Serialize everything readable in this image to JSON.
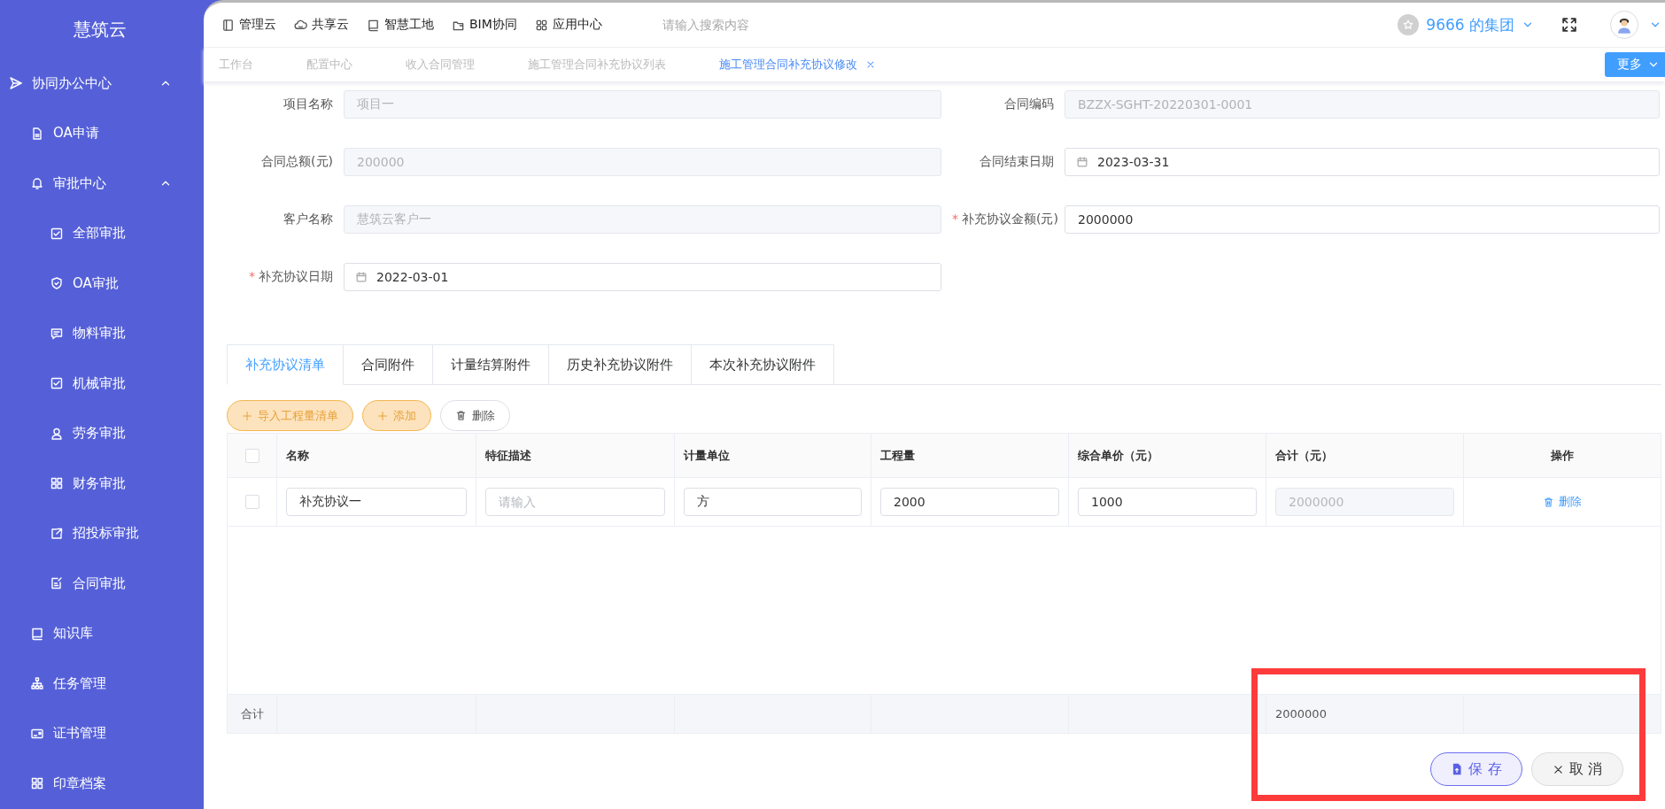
{
  "sidebar": {
    "logo": "慧筑云",
    "items": [
      {
        "label": "协同办公中心",
        "expanded": true,
        "children": [
          {
            "label": "OA申请"
          },
          {
            "label": "审批中心",
            "expanded": true,
            "children": [
              {
                "label": "全部审批"
              },
              {
                "label": "OA审批"
              },
              {
                "label": "物料审批"
              },
              {
                "label": "机械审批"
              },
              {
                "label": "劳务审批"
              },
              {
                "label": "财务审批"
              },
              {
                "label": "招投标审批"
              },
              {
                "label": "合同审批"
              }
            ]
          },
          {
            "label": "知识库"
          },
          {
            "label": "任务管理"
          },
          {
            "label": "证书管理"
          },
          {
            "label": "印章档案"
          }
        ]
      }
    ]
  },
  "top_nav": {
    "items": [
      {
        "label": "管理云"
      },
      {
        "label": "共享云"
      },
      {
        "label": "智慧工地"
      },
      {
        "label": "BIM协同"
      },
      {
        "label": "应用中心"
      }
    ],
    "search": {
      "placeholder": "请输入搜索内容"
    },
    "organization": "9666 的集团"
  },
  "page_tabs": {
    "items": [
      {
        "label": "工作台",
        "selected": false
      },
      {
        "label": "配置中心",
        "selected": false
      },
      {
        "label": "收入合同管理",
        "selected": false
      },
      {
        "label": "施工管理合同补充协议列表",
        "selected": false
      },
      {
        "label": "施工管理合同补充协议修改",
        "selected": true,
        "closable": true
      }
    ],
    "more": "更多"
  },
  "form": {
    "fields": [
      {
        "label": "项目名称",
        "value": "项目一",
        "kind": "text",
        "disabled": true
      },
      {
        "label": "合同编码",
        "value": "BZZX-SGHT-20220301-0001",
        "kind": "text",
        "disabled": true
      },
      {
        "label": "合同总额(元)",
        "value": "200000",
        "kind": "text",
        "disabled": true
      },
      {
        "label": "合同结束日期",
        "value": "2023-03-31",
        "kind": "date",
        "disabled": false
      },
      {
        "label": "客户名称",
        "value": "慧筑云客户一",
        "kind": "text",
        "disabled": true
      },
      {
        "label": "补充协议金额(元)",
        "value": "2000000",
        "kind": "text",
        "disabled": false,
        "required_mark": "*"
      },
      {
        "label": "补充协议日期",
        "value": "2022-03-01",
        "kind": "date",
        "disabled": false,
        "required_mark": "*"
      }
    ]
  },
  "detail_tabs": [
    {
      "label": "补充协议清单",
      "selected": true
    },
    {
      "label": "合同附件",
      "selected": false
    },
    {
      "label": "计量结算附件",
      "selected": false
    },
    {
      "label": "历史补充协议附件",
      "selected": false
    },
    {
      "label": "本次补充协议附件",
      "selected": false
    }
  ],
  "toolbar": [
    {
      "label": "导入工程量清单",
      "kind": "warning"
    },
    {
      "label": "添加",
      "kind": "warning"
    },
    {
      "label": "删除",
      "kind": "default"
    }
  ],
  "table": {
    "select_all": {
      "checked": false
    },
    "columns": [
      "名称",
      "特征描述",
      "计量单位",
      "工程量",
      "综合单价（元）",
      "合计（元）",
      "操作"
    ],
    "rows": [
      {
        "checked": false,
        "cells": [
          {
            "kind": "input",
            "value": "补充协议一"
          },
          {
            "kind": "input",
            "placeholder": "请输入"
          },
          {
            "kind": "input",
            "value": "方"
          },
          {
            "kind": "input",
            "value": "2000"
          },
          {
            "kind": "input",
            "value": "1000"
          },
          {
            "kind": "disabled",
            "value": "2000000"
          },
          {
            "kind": "action",
            "label": "删除"
          }
        ]
      }
    ],
    "footer": {
      "label": "合计",
      "total": "2000000"
    }
  },
  "actions": [
    {
      "label": "保 存",
      "kind": "primary"
    },
    {
      "label": "取 消",
      "kind": "cancel"
    }
  ],
  "annotations": [
    {
      "kind": "rectangle"
    }
  ]
}
